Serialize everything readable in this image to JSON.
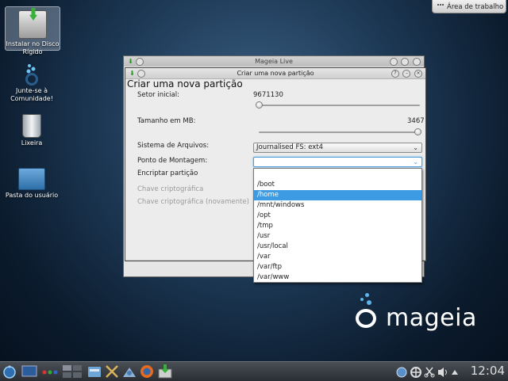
{
  "desktop": {
    "icons": [
      {
        "label": "Instalar no Disco Rígido",
        "icon": "installer-icon"
      },
      {
        "label": "Junte-se à Comunidade!",
        "icon": "community-icon"
      },
      {
        "label": "Lixeira",
        "icon": "trash-icon"
      },
      {
        "label": "Pasta do usuário",
        "icon": "home-folder-icon"
      }
    ],
    "cashew_label": "Área de trabalho"
  },
  "back_window": {
    "title": "Mageia Live"
  },
  "dialog": {
    "title": "Criar uma nova partição",
    "heading": "Criar uma nova partição",
    "start_sector": {
      "label": "Setor inicial:",
      "value": "9671130",
      "slider_fraction": 0.0
    },
    "size": {
      "label": "Tamanho em MB:",
      "value": "3467",
      "slider_fraction": 1.0
    },
    "filesystem": {
      "label": "Sistema de Arquivos:",
      "value": "Journalised FS: ext4"
    },
    "mount_point": {
      "label": "Ponto de Montagem:",
      "value": ""
    },
    "encrypt": {
      "label": "Encriptar partição"
    },
    "key": {
      "label": "Chave criptográfica"
    },
    "key_again": {
      "label": "Chave criptográfica (novamente)"
    }
  },
  "mount_options": [
    "",
    "/boot",
    "/home",
    "/mnt/windows",
    "/opt",
    "/tmp",
    "/usr",
    "/usr/local",
    "/var",
    "/var/ftp",
    "/var/www"
  ],
  "mount_selected": "/home",
  "brand": {
    "name": "mageia",
    "accent": "#5fb4ea"
  },
  "taskbar": {
    "clock": "12:04",
    "icons": [
      "app-launcher-icon",
      "show-desktop-icon",
      "activity-icon",
      "pager-icon",
      "file-manager-icon",
      "tools-icon",
      "display-icon",
      "firefox-icon",
      "installer-icon",
      "network-icon",
      "update-icon",
      "scissors-icon",
      "volume-icon",
      "arrow-up-icon"
    ]
  }
}
